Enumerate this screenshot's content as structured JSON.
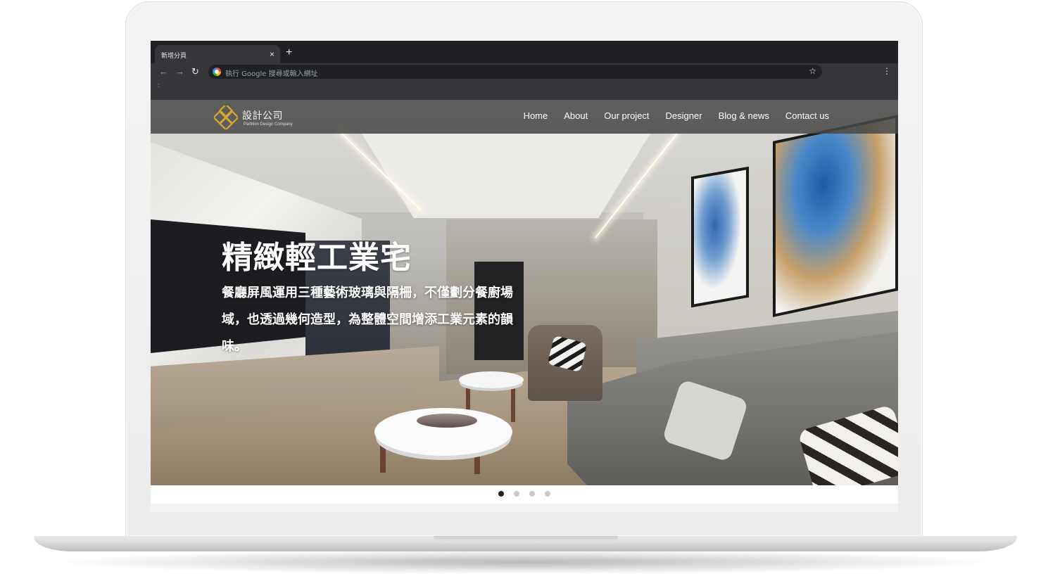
{
  "browser": {
    "tab_title": "新增分頁",
    "tab_close": "×",
    "new_tab": "+",
    "back": "←",
    "forward": "→",
    "reload": "↻",
    "omnibox_placeholder": "執行 Google 搜尋或輸入網址",
    "star": "☆",
    "menu": "⋮",
    "bookmarks": ":"
  },
  "site": {
    "logo": {
      "text": "設計公司",
      "subtitle": "Partition Design Company",
      "icon": "gold-diamond-logo-icon",
      "accent_color": "#d8a531"
    },
    "nav": [
      {
        "label": "Home"
      },
      {
        "label": "About"
      },
      {
        "label": "Our project"
      },
      {
        "label": "Designer"
      },
      {
        "label": "Blog & news"
      },
      {
        "label": "Contact us"
      }
    ],
    "hero": {
      "title": "精緻輕工業宅",
      "description": "餐廳屏風運用三種藝術玻璃與隔柵，不僅劃分餐廚場域，也透過幾何造型，為整體空間增添工業元素的韻味。"
    },
    "carousel": {
      "slide_count": 4,
      "active_index": 0
    }
  },
  "colors": {
    "chrome_dark": "#202124",
    "chrome_toolbar": "#35363a",
    "header_overlay": "#484848",
    "dot_active": "#222222",
    "dot_inactive": "#c9c9c9"
  }
}
